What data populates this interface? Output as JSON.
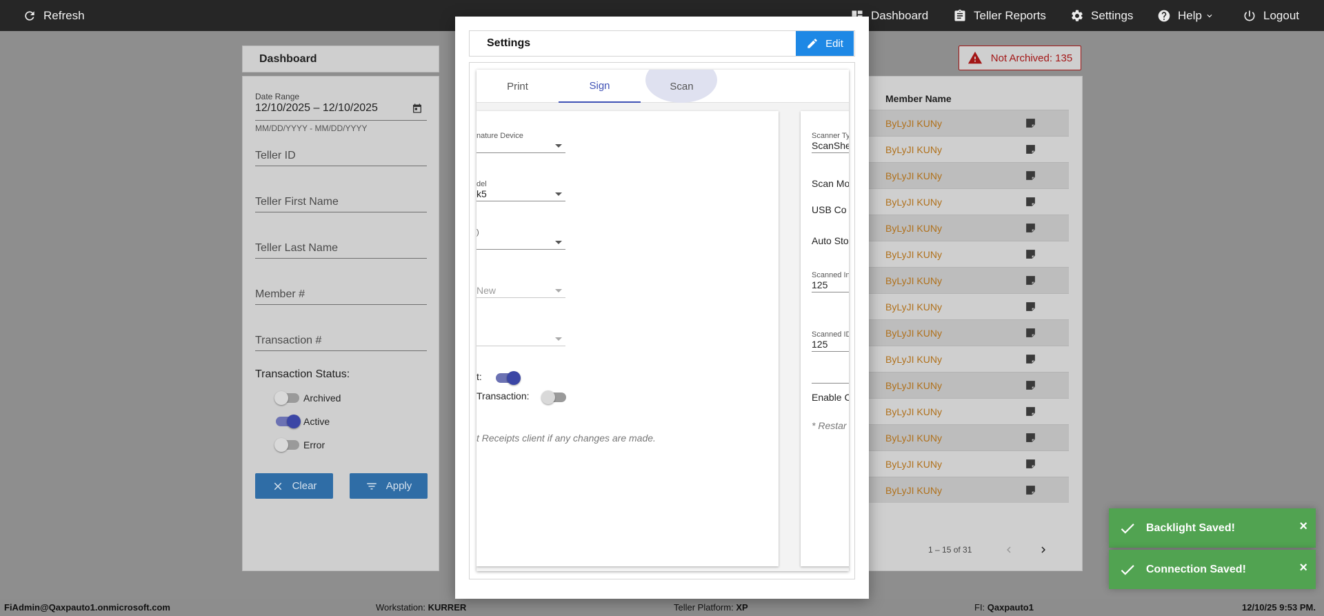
{
  "topbar": {
    "refresh": "Refresh",
    "dashboard": "Dashboard",
    "teller_reports": "Teller Reports",
    "settings": "Settings",
    "help": "Help",
    "logout": "Logout"
  },
  "dashboard": {
    "title": "Dashboard",
    "date_range_label": "Date Range",
    "date_range_value": "12/10/2025 – 12/10/2025",
    "date_hint": "MM/DD/YYYY - MM/DD/YYYY",
    "teller_id": "Teller ID",
    "teller_first_name": "Teller First Name",
    "teller_last_name": "Teller Last Name",
    "member_num": "Member #",
    "transaction_num": "Transaction #",
    "status_title": "Transaction Status:",
    "statuses": [
      {
        "label": "Archived",
        "on": false
      },
      {
        "label": "Active",
        "on": true
      },
      {
        "label": "Error",
        "on": false
      }
    ],
    "clear": "Clear",
    "apply": "Apply"
  },
  "not_archived": "Not Archived: 135",
  "table": {
    "member_name_header": "Member Name",
    "rows": [
      "ByLyJI KUNy",
      "ByLyJI KUNy",
      "ByLyJI KUNy",
      "ByLyJI KUNy",
      "ByLyJI KUNy",
      "ByLyJI KUNy",
      "ByLyJI KUNy",
      "ByLyJI KUNy",
      "ByLyJI KUNy",
      "ByLyJI KUNy",
      "ByLyJI KUNy",
      "ByLyJI KUNy",
      "ByLyJI KUNy",
      "ByLyJI KUNy",
      "ByLyJI KUNy"
    ],
    "pager": "1 – 15 of 31"
  },
  "modal": {
    "title": "Settings",
    "edit": "Edit",
    "tabs": [
      "Print",
      "Sign",
      "Scan"
    ],
    "active_tab": "Sign",
    "left": {
      "signature_device_label": "nature Device",
      "model_label": "del",
      "model_value": "k5",
      "field3_label": "",
      "field4_value": "New",
      "toggle1_label": "t:",
      "toggle2_label": "Transaction:",
      "note": "t Receipts client if any changes are made."
    },
    "right": {
      "scanner_type_label": "Scanner Ty",
      "scanner_type_value": "ScanShe",
      "scan_mode": "Scan Mo",
      "usb_con": "USB Co",
      "auto_store": "Auto Sto",
      "scanned_img_label": "Scanned In",
      "scanned_img_value": "125",
      "scanned_id_label": "Scanned ID",
      "scanned_id_value": "125",
      "enable": "Enable C",
      "restart_note": "* Restar"
    }
  },
  "statusbar": {
    "user": "FiAdmin@Qaxpauto1.onmicrosoft.com",
    "workstation_label": "Workstation:",
    "workstation_value": "KURRER",
    "platform_label": "Teller Platform:",
    "platform_value": "XP",
    "fi_label": "FI:",
    "fi_value": "Qaxpauto1",
    "datetime": "12/10/25 9:53 PM."
  },
  "toasts": [
    "Backlight Saved!",
    "Connection Saved!"
  ],
  "colors": {
    "accent": "#1e88e5",
    "tab_active": "#3f51b5",
    "toast_green": "#51a351",
    "warning_red": "#a31616",
    "member_link": "#b0701a"
  }
}
